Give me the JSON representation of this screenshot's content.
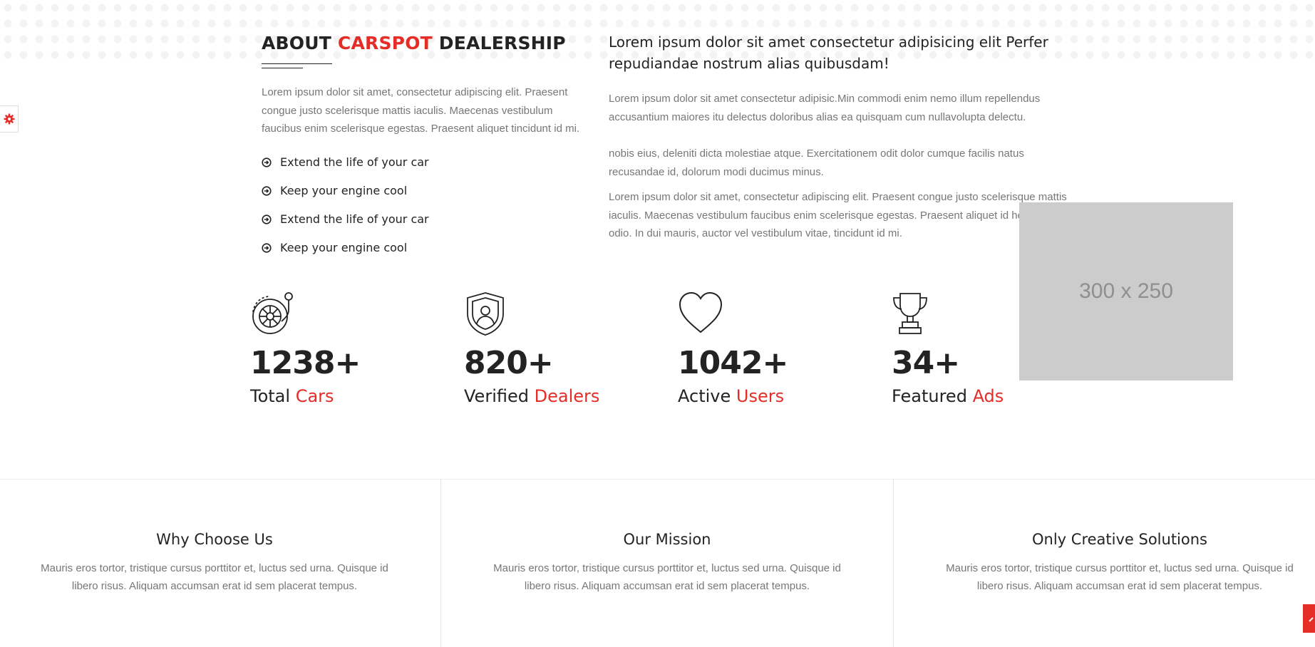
{
  "about": {
    "title_part1": "ABOUT ",
    "title_accent": "CARSPOT",
    "title_part2": " DEALERSHIP",
    "description": "Lorem ipsum dolor sit amet, consectetur adipiscing elit. Praesent congue justo scelerisque mattis iaculis. Maecenas vestibulum faucibus enim scelerisque egestas. Praesent aliquet tincidunt id mi.",
    "features": [
      "Extend the life of your car",
      "Keep your engine cool",
      "Extend the life of your car",
      "Keep your engine cool"
    ]
  },
  "intro": {
    "heading": "Lorem ipsum dolor sit amet consectetur adipisicing elit Perfer repudiandae nostrum alias quibusdam!",
    "paragraph1": "Lorem ipsum dolor sit amet consectetur adipisic.Min commodi enim nemo illum repellendus accusantium maiores itu delectus doloribus alias ea quisquam cum nullavolupta delectu.",
    "paragraph2": "nobis eius, deleniti dicta molestiae atque. Exercitationem odit dolor cumque facilis natus recusandae id, dolorum modi ducimus minus.",
    "paragraph3": "Lorem ipsum dolor sit amet, consectetur adipiscing elit. Praesent congue justo scelerisque mattis iaculis. Maecenas vestibulum faucibus enim scelerisque egestas. Praesent aliquet id hendrerit ac odio. In dui mauris, auctor vel vestibulum vitae, tincidunt id mi."
  },
  "ad": {
    "label": "300 x 250"
  },
  "stats": [
    {
      "icon": "tire-icon",
      "number": "1238+",
      "label": "Total ",
      "accent": "Cars"
    },
    {
      "icon": "shield-user-icon",
      "number": "820+",
      "label": "Verified ",
      "accent": "Dealers"
    },
    {
      "icon": "heart-icon",
      "number": "1042+",
      "label": "Active ",
      "accent": "Users"
    },
    {
      "icon": "trophy-icon",
      "number": "34+",
      "label": "Featured ",
      "accent": "Ads"
    }
  ],
  "boxes": [
    {
      "title": "Why Choose Us",
      "text": "Mauris eros tortor, tristique cursus porttitor et, luctus sed urna. Quisque id libero risus. Aliquam accumsan erat id sem placerat tempus."
    },
    {
      "title": "Our Mission",
      "text": "Mauris eros tortor, tristique cursus porttitor et, luctus sed urna. Quisque id libero risus. Aliquam accumsan erat id sem placerat tempus."
    },
    {
      "title": "Only Creative Solutions",
      "text": "Mauris eros tortor, tristique cursus porttitor et, luctus sed urna. Quisque id libero risus. Aliquam accumsan erat id sem placerat tempus."
    }
  ],
  "colors": {
    "accent": "#e52d27",
    "heading": "#232323",
    "body": "#777777"
  },
  "widgets": {
    "settings_icon": "gear-icon",
    "scroll_top_icon": "chevron-up-icon"
  }
}
